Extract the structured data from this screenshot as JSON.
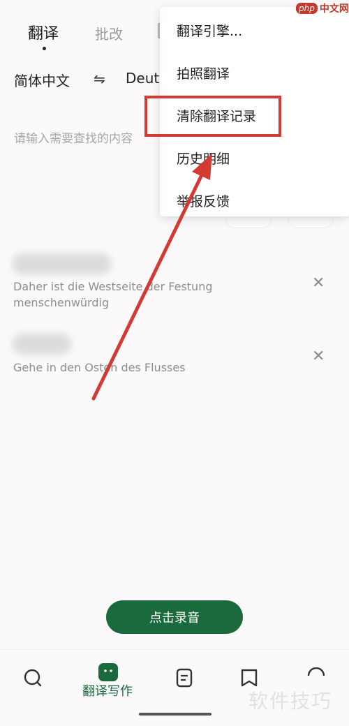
{
  "top_tabs": {
    "active": "翻译",
    "second": "批改"
  },
  "language": {
    "source": "简体中文",
    "swap_icon": "⇋",
    "target": "Deuts"
  },
  "input": {
    "placeholder": "请输入需要查找的内容"
  },
  "history": [
    {
      "text": "Daher ist die Westseite der Festung menschenwürdig"
    },
    {
      "text": "Gehe in den Osten des Flusses"
    }
  ],
  "record_button": {
    "label": "点击录音"
  },
  "bottom_nav": {
    "active_label": "翻译写作"
  },
  "menu": {
    "items": [
      "翻译引擎...",
      "拍照翻译",
      "清除翻译记录",
      "历史明细",
      "举报反馈"
    ]
  },
  "watermark": {
    "text": "软件技巧"
  },
  "logo": {
    "mark": "php",
    "text": "中文网"
  },
  "colors": {
    "accent": "#1a6a3d",
    "annotation": "#d33a34"
  },
  "icons": [
    "search-icon",
    "document-icon",
    "bookmark-icon",
    "profile-icon",
    "close-icon"
  ]
}
